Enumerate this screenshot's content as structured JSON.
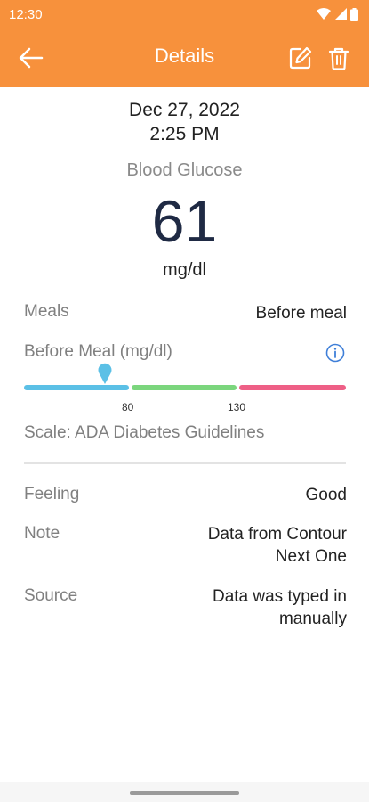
{
  "status_bar": {
    "time": "12:30",
    "icons": [
      "wifi-icon",
      "signal-icon",
      "battery-icon"
    ]
  },
  "app_bar": {
    "title": "Details",
    "icons": [
      "back-arrow-icon",
      "edit-icon",
      "trash-icon"
    ],
    "color": "#F7913C"
  },
  "reading": {
    "date": "Dec 27, 2022",
    "time": "2:25 PM",
    "type": "Blood Glucose",
    "value": "61",
    "unit": "mg/dl"
  },
  "meals": {
    "label": "Meals",
    "value": "Before meal"
  },
  "range": {
    "label": "Before Meal (mg/dl)",
    "low_threshold": "80",
    "high_threshold": "130",
    "scale_text": "Scale: ADA Diabetes Guidelines",
    "colors": {
      "low": "#5BC0E6",
      "normal": "#7BD67D",
      "high": "#EE5F86"
    }
  },
  "details": [
    {
      "label": "Feeling",
      "value": "Good"
    },
    {
      "label": "Note",
      "value_lines": [
        "Data from Contour",
        "Next One"
      ]
    },
    {
      "label": "Source",
      "value_lines": [
        "Data was typed in",
        "manually"
      ]
    }
  ]
}
